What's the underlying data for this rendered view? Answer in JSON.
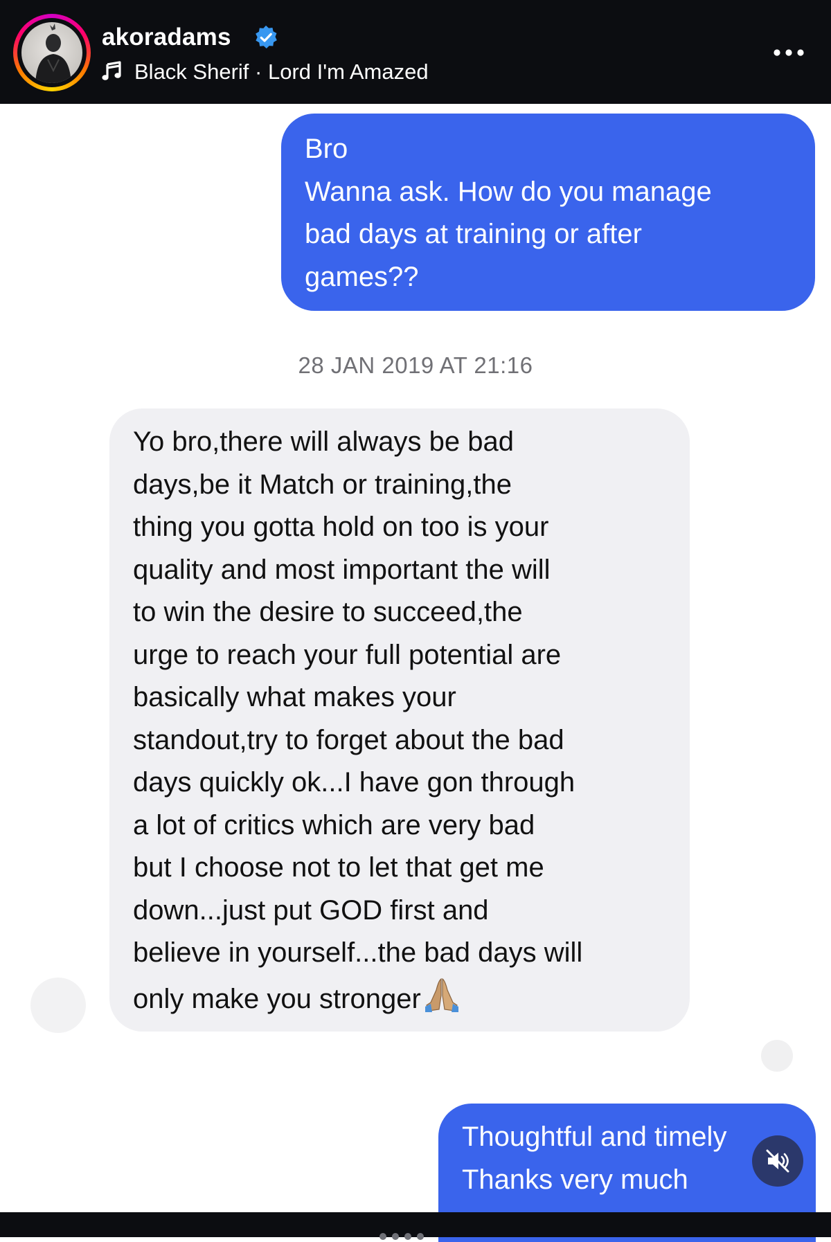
{
  "header": {
    "username": "akoradams",
    "music_artist": "Black Sherif",
    "music_separator": " · ",
    "music_track": "Lord I'm Amazed",
    "accent_ring_colors": [
      "#d300c5",
      "#ff0069",
      "#ff7a00",
      "#ffd600"
    ],
    "verified_color": "#3897f0",
    "icons": [
      "verified-badge-icon",
      "music-note-icon",
      "more-options-icon"
    ]
  },
  "messages": [
    {
      "direction": "sent",
      "lines": [
        "Bro",
        "Wanna ask. How do you manage",
        "bad days at training or after",
        "games??"
      ]
    },
    {
      "direction": "received",
      "timestamp": "28 JAN 2019 AT 21:16",
      "lines": [
        "Yo bro,there will always be bad",
        "days,be it Match or training,the",
        "thing you gotta hold on too is your",
        "quality and most important the will",
        "to win the desire to succeed,the",
        "urge to reach your full potential are",
        "basically what makes your",
        "standout,try to forget about the bad",
        "days quickly ok...I have gon through",
        "a lot of critics which are very bad",
        "but I choose not to let that get me",
        "down...just put GOD first and",
        "believe in yourself...the bad days will",
        "only make you stronger"
      ],
      "emoji": "folded-hands"
    },
    {
      "direction": "sent",
      "lines": [
        "Thoughtful and timely",
        "Thanks very much"
      ]
    }
  ],
  "colors": {
    "sent_bubble": "#3a64ec",
    "received_bubble": "#f0f0f3",
    "header_bg": "#0c0d11"
  },
  "controls": {
    "mute_icon": "speaker-muted-icon"
  }
}
